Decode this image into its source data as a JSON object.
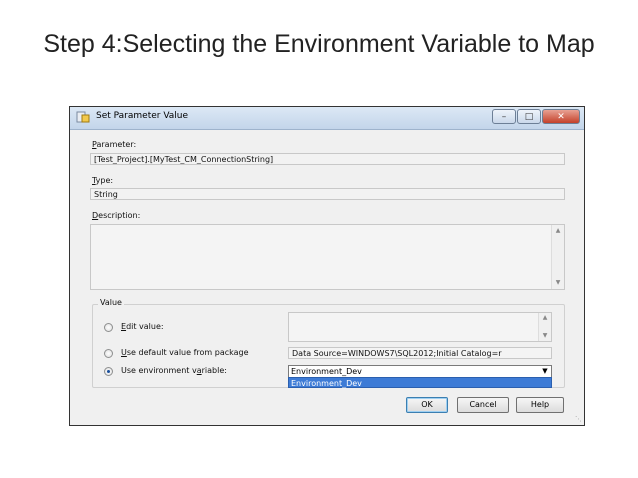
{
  "slide": {
    "title": "Step 4:Selecting the Environment Variable to Map"
  },
  "dialog": {
    "title": "Set Parameter Value",
    "window_buttons": {
      "minimize": "–",
      "maximize": "□",
      "close": "✕"
    },
    "parameter": {
      "label_accel": "P",
      "label_rest": "arameter:",
      "value": "[Test_Project].[MyTest_CM_ConnectionString]"
    },
    "type": {
      "label_accel": "T",
      "label_rest": "ype:",
      "value": "String"
    },
    "description": {
      "label_accel": "D",
      "label_rest": "escription:",
      "value": ""
    },
    "value_group": {
      "label": "Value",
      "edit_value": {
        "label_accel": "E",
        "label_rest": "dit value:",
        "selected": false,
        "value": ""
      },
      "use_default": {
        "label_accel": "U",
        "label_rest": "se default value from package",
        "selected": false,
        "value": "Data Source=WINDOWS7\\SQL2012;Initial Catalog=r"
      },
      "use_env": {
        "label_pre": "Use environment v",
        "label_accel": "a",
        "label_post": "riable:",
        "selected": true,
        "selected_value": "Environment_Dev",
        "options": [
          "Environment_Dev"
        ]
      }
    },
    "buttons": {
      "ok": "OK",
      "cancel": "Cancel",
      "help": "Help"
    }
  }
}
